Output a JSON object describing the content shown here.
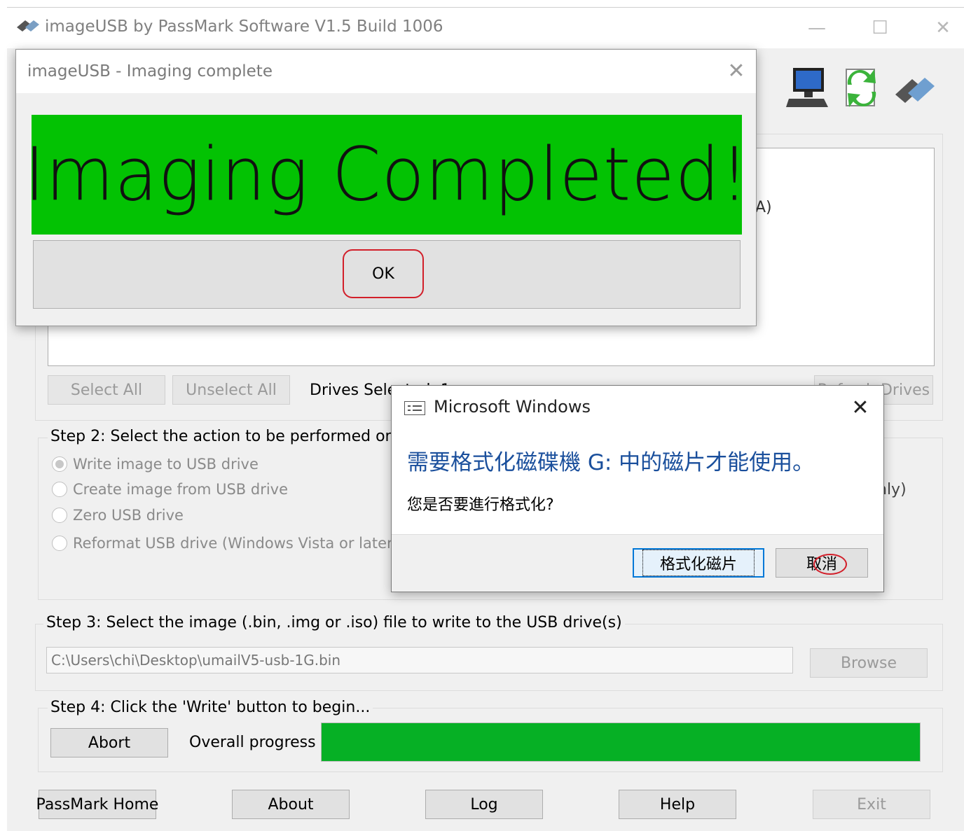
{
  "window": {
    "title": "imageUSB by PassMark Software V1.5 Build 1006",
    "minimize_glyph": "—",
    "maximize_glyph": "☐",
    "close_glyph": "✕"
  },
  "step1": {
    "drive_entry_fragment": "A)",
    "select_all": "Select All",
    "unselect_all": "Unselect All",
    "drives_selected_label": "Drives Selected: 1",
    "refresh_drives": "Refresh Drives"
  },
  "step2": {
    "title": "Step 2: Select the action to be performed on the selected USB drive(s)",
    "options": [
      {
        "label": "Write image to USB drive",
        "selected": true
      },
      {
        "label": "Create image from USB drive",
        "selected": false
      },
      {
        "label": "Zero USB drive",
        "selected": false
      },
      {
        "label": "Reformat USB drive (Windows Vista or later)",
        "selected": false
      }
    ],
    "right_fragment": "nly)"
  },
  "step3": {
    "title": "Step 3: Select the image (.bin, .img or .iso) file to write to the USB drive(s)",
    "image_path": "C:\\Users\\chi\\Desktop\\umailV5-usb-1G.bin",
    "browse": "Browse"
  },
  "step4": {
    "title": "Step 4: Click the 'Write' button to begin...",
    "abort": "Abort",
    "progress_label": "Overall progress",
    "progress_percent": 100,
    "progress_color": "#06b025"
  },
  "bottom_buttons": {
    "passmark_home": "PassMark Home",
    "about": "About",
    "log": "Log",
    "help": "Help",
    "exit": "Exit"
  },
  "complete_dialog": {
    "title": "imageUSB - Imaging complete",
    "banner": "Imaging Completed!",
    "banner_color": "#03c203",
    "ok": "OK",
    "close_glyph": "✕"
  },
  "ms_dialog": {
    "title": "Microsoft Windows",
    "heading": "需要格式化磁碟機 G: 中的磁片才能使用。",
    "body": "您是否要進行格式化?",
    "format_button": "格式化磁片",
    "cancel_button": "取消",
    "close_glyph": "✕"
  },
  "icons": [
    "usb-drive-icon",
    "computer-icon",
    "refresh-arrows-icon",
    "usb-stick-icon"
  ]
}
